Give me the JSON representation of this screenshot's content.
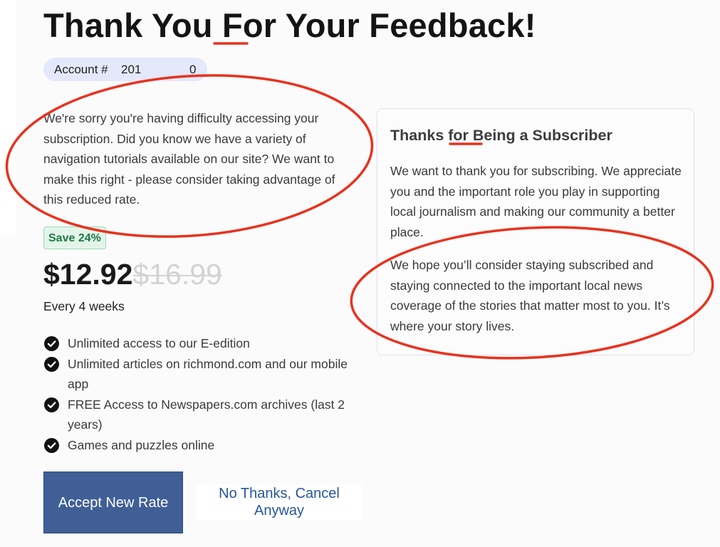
{
  "page": {
    "title": "Thank You For Your Feedback!"
  },
  "account": {
    "label": "Account #",
    "number_part_a": "201",
    "number_part_b": "0"
  },
  "intro_text": "We're sorry you're having difficulty accessing your subscription. Did you know we have a variety of navigation tutorials available on our site? We want to make this right - please consider taking advantage of this reduced rate.",
  "offer": {
    "save_label": "Save 24%",
    "new_price": "$12.92",
    "old_price": "$16.99",
    "frequency": "Every 4 weeks",
    "features": [
      "Unlimited access to our E-edition",
      "Unlimited articles on richmond.com and our mobile app",
      "FREE Access to Newspapers.com archives (last 2 years)",
      "Games and puzzles online"
    ],
    "check_icon": "check-circle-icon"
  },
  "buttons": {
    "accept_label": "Accept New Rate",
    "decline_label": "No Thanks, Cancel Anyway"
  },
  "side_card": {
    "title": "Thanks for Being a Subscriber",
    "paragraph_1": "We want to thank you for subscribing. We appreciate you and the important role you play in supporting local journalism and making our community a better place.",
    "paragraph_2": "We hope you’ll consider staying subscribed and staying connected to the important local news coverage of the stories that matter most to you. It’s where your story lives."
  },
  "colors": {
    "accent_button": "#3f5f96",
    "link_blue": "#27569a",
    "save_green": "#1d7a43",
    "annotation_red": "#e8321e",
    "badge_bg": "#e3e8fb"
  }
}
